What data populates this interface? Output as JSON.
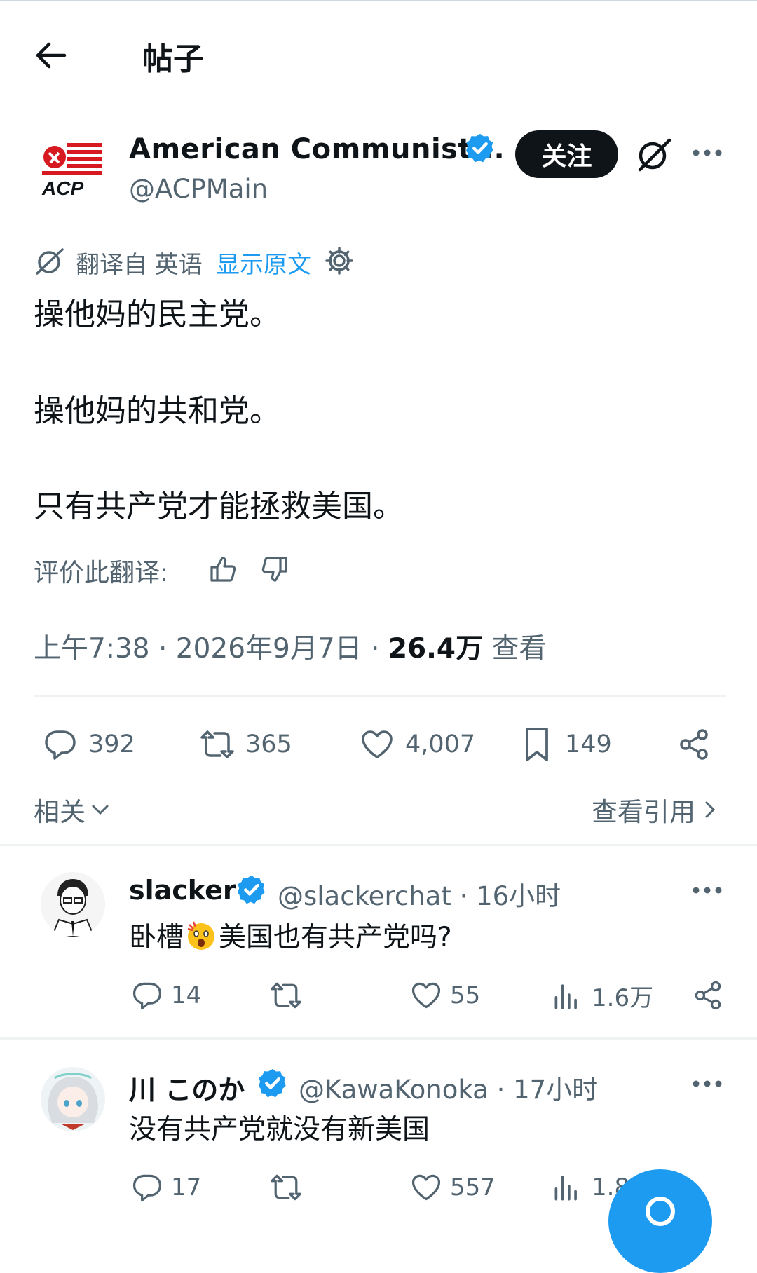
{
  "header": {
    "title": "帖子",
    "back_icon": "arrow-left-icon"
  },
  "post": {
    "author_name": "American Communist...",
    "author_handle": "@ACPMain",
    "avatar_text": "ACP",
    "follow_label": "关注",
    "translation": {
      "label": "翻译自 英语",
      "show_original": "显示原文"
    },
    "body": [
      "操他妈的民主党。",
      "操他妈的共和党。",
      "只有共产党才能拯救美国。"
    ],
    "rate_label": "评价此翻译:",
    "meta": {
      "time": "上午7:38 · 2026年9月7日 · ",
      "views": "26.4万",
      "views_label": " 查看"
    },
    "stats": {
      "replies": "392",
      "reposts": "365",
      "likes": "4,007",
      "bookmarks": "149"
    },
    "related_label": "相关",
    "quotes_label": "查看引用"
  },
  "replies": [
    {
      "name": "slacker",
      "handle": "@slackerchat · 16小时",
      "text_before": "卧槽",
      "text_after": "美国也有共产党吗?",
      "replies": "14",
      "likes": "55",
      "views": "1.6万"
    },
    {
      "name": "川 このか",
      "handle": "@KawaKonoka · 17小时",
      "text": "没有共产党就没有新美国",
      "replies": "17",
      "likes": "557",
      "views": "1.8"
    }
  ],
  "colors": {
    "accent": "#1d9bf0",
    "text": "#0f1419",
    "muted": "#536471",
    "acp_red": "#d71a21"
  }
}
